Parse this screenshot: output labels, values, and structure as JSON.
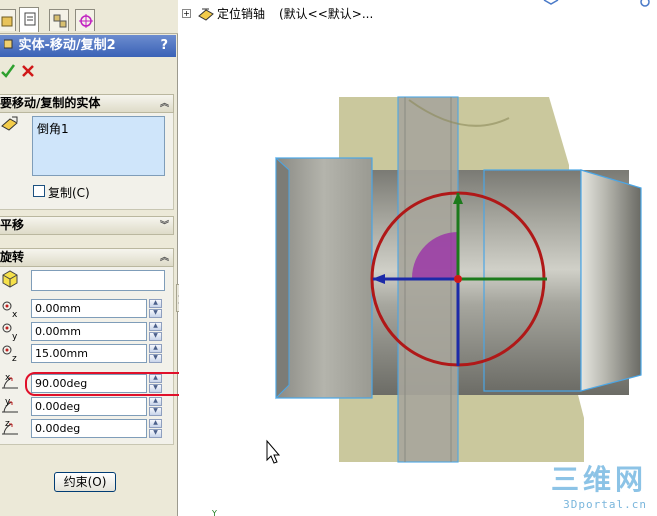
{
  "property_manager": {
    "title": "实体-移动/复制2",
    "help": "?",
    "ok_icon": "check-icon",
    "cancel_icon": "close-icon",
    "groups": {
      "bodies": {
        "header": "要移动/复制的实体",
        "selected_items": [
          "倒角1"
        ],
        "copy_label": "复制(C)",
        "copy_checked": false
      },
      "translate": {
        "header": "平移"
      },
      "rotate": {
        "header": "旋转",
        "reference_value": "",
        "x_origin": "0.00mm",
        "y_origin": "0.00mm",
        "z_origin": "15.00mm",
        "x_angle": "90.00deg",
        "y_angle": "0.00deg",
        "z_angle": "0.00deg"
      }
    },
    "constraint_button": "约束(O)"
  },
  "viewport": {
    "tree_item_label": "定位销轴",
    "tree_item_meta": "(默认<<默认>...",
    "tree_expand": "+"
  },
  "watermark": {
    "logo_text": "三维网",
    "url_text": "3Dportal.cn"
  },
  "colors": {
    "title_bar": "#4a6fc0",
    "highlight": "#e0102a",
    "triad_ring": "#b01818",
    "axis_green": "#1c7a1c",
    "axis_blue": "#1c2aa8",
    "part_edge": "#4aa6e6"
  }
}
